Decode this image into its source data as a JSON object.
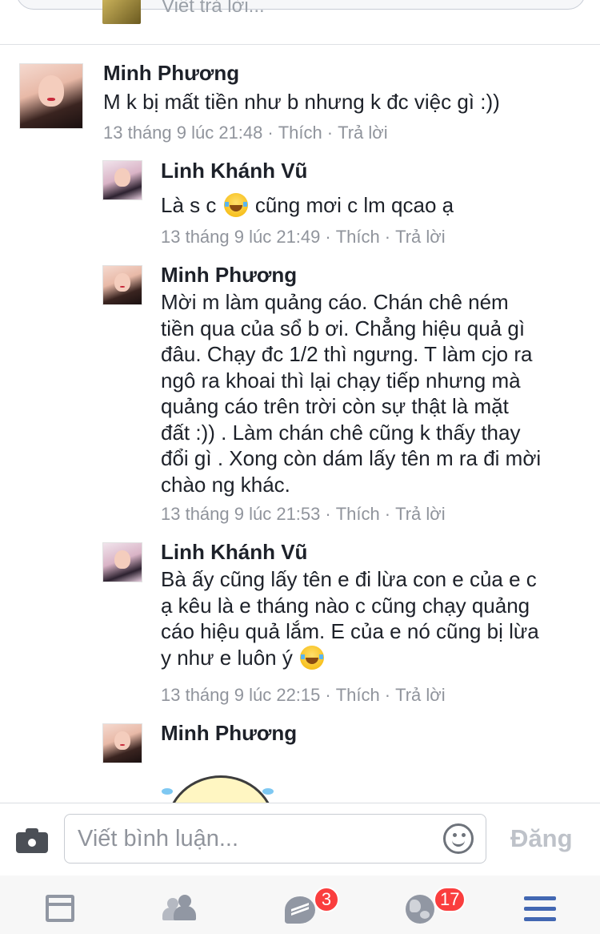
{
  "top_reply": {
    "placeholder": "Viết trả lời..."
  },
  "comments": [
    {
      "name": "Minh Phương",
      "text": "M k bị mất tiền như b nhưng k đc việc gì :))",
      "time": "13 tháng 9 lúc 21:48",
      "like": "Thích",
      "reply": "Trả lời"
    },
    {
      "name": "Linh Khánh Vũ",
      "text_before": "Là s c",
      "text_after": "cũng mơi c lm qcao ạ",
      "time": "13 tháng 9 lúc 21:49",
      "like": "Thích",
      "reply": "Trả lời"
    },
    {
      "name": "Minh Phương",
      "lines": [
        "Mời m làm quảng cáo. Chán chê ném",
        "tiền qua của sổ b ơi. Chẳng hiệu quả gì",
        "đâu. Chạy đc 1/2 thì ngưng. T làm cjo ra",
        "ngô ra khoai thì lại chạy tiếp nhưng mà",
        "quảng cáo trên trời còn sự thật là mặt",
        "đất :)) . Làm chán chê cũng k thấy thay",
        "đổi gì . Xong còn dám lấy tên m ra đi mời",
        "chào ng khác."
      ],
      "time": "13 tháng 9 lúc 21:53",
      "like": "Thích",
      "reply": "Trả lời"
    },
    {
      "name": "Linh Khánh Vũ",
      "lines": [
        "Bà ấy cũng lấy tên e đi lừa con e của e c",
        "ạ kêu là e tháng nào c cũng chạy quảng",
        "cáo hiệu quả lắm. E của e nó cũng bị lừa",
        "y như e luôn ý"
      ],
      "time": "13 tháng 9 lúc 22:15",
      "like": "Thích",
      "reply": "Trả lời"
    },
    {
      "name": "Minh Phương"
    }
  ],
  "composer": {
    "placeholder": "Viết bình luận...",
    "post_label": "Đăng"
  },
  "tabbar": {
    "messages_badge": "3",
    "notifications_badge": "17"
  },
  "colors": {
    "name_text": "#1d2129",
    "meta_text": "#90949c",
    "badge": "#fa3e3e",
    "menu_active": "#4267b2",
    "post_disabled": "#bec2c9"
  }
}
